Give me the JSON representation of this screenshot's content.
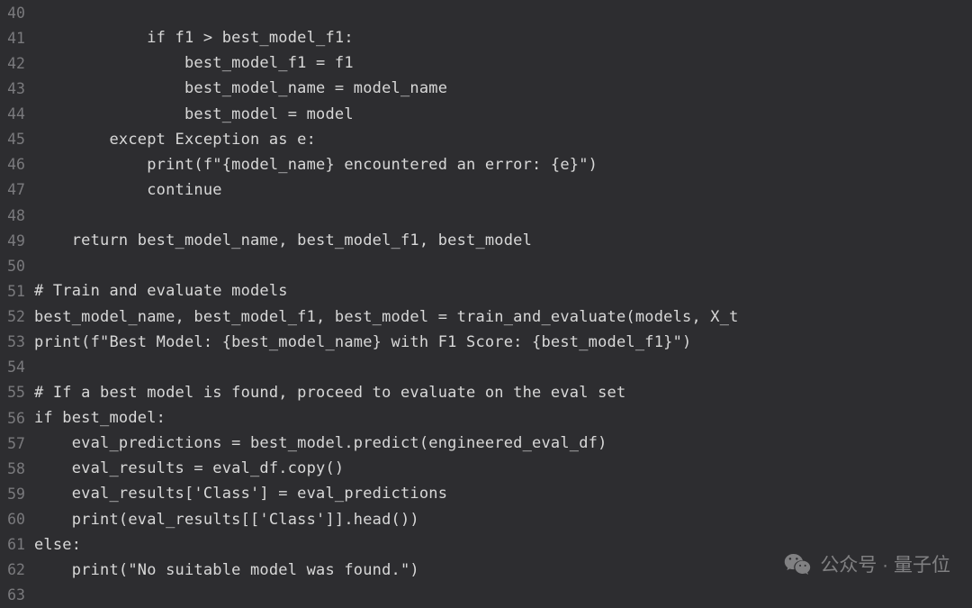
{
  "lines": [
    {
      "num": "40",
      "text": ""
    },
    {
      "num": "41",
      "text": "            if f1 > best_model_f1:"
    },
    {
      "num": "42",
      "text": "                best_model_f1 = f1"
    },
    {
      "num": "43",
      "text": "                best_model_name = model_name"
    },
    {
      "num": "44",
      "text": "                best_model = model"
    },
    {
      "num": "45",
      "text": "        except Exception as e:"
    },
    {
      "num": "46",
      "text": "            print(f\"{model_name} encountered an error: {e}\")"
    },
    {
      "num": "47",
      "text": "            continue"
    },
    {
      "num": "48",
      "text": ""
    },
    {
      "num": "49",
      "text": "    return best_model_name, best_model_f1, best_model"
    },
    {
      "num": "50",
      "text": ""
    },
    {
      "num": "51",
      "text": "# Train and evaluate models"
    },
    {
      "num": "52",
      "text": "best_model_name, best_model_f1, best_model = train_and_evaluate(models, X_t"
    },
    {
      "num": "53",
      "text": "print(f\"Best Model: {best_model_name} with F1 Score: {best_model_f1}\")"
    },
    {
      "num": "54",
      "text": ""
    },
    {
      "num": "55",
      "text": "# If a best model is found, proceed to evaluate on the eval set"
    },
    {
      "num": "56",
      "text": "if best_model:"
    },
    {
      "num": "57",
      "text": "    eval_predictions = best_model.predict(engineered_eval_df)"
    },
    {
      "num": "58",
      "text": "    eval_results = eval_df.copy()"
    },
    {
      "num": "59",
      "text": "    eval_results['Class'] = eval_predictions"
    },
    {
      "num": "60",
      "text": "    print(eval_results[['Class']].head())"
    },
    {
      "num": "61",
      "text": "else:"
    },
    {
      "num": "62",
      "text": "    print(\"No suitable model was found.\")"
    },
    {
      "num": "63",
      "text": ""
    }
  ],
  "watermark": {
    "label": "公众号 · 量子位"
  }
}
